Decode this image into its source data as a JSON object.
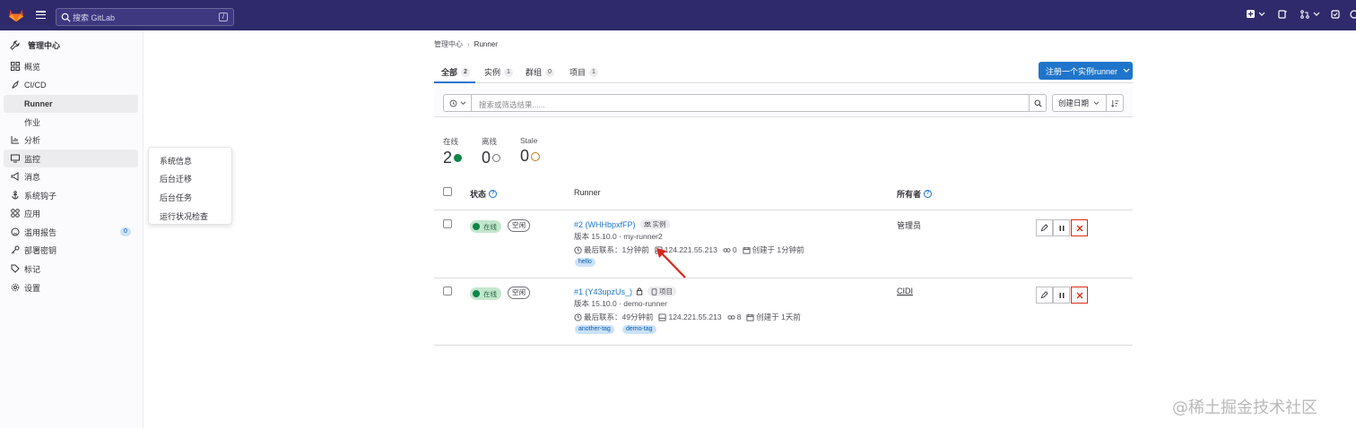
{
  "topbar": {
    "search_placeholder": "搜索 GitLab",
    "search_shortcut": "/"
  },
  "sidebar": {
    "header": "管理中心",
    "items": [
      {
        "label": "概览"
      },
      {
        "label": "CI/CD"
      },
      {
        "label": "Runner"
      },
      {
        "label": "作业"
      },
      {
        "label": "分析"
      },
      {
        "label": "监控"
      },
      {
        "label": "消息"
      },
      {
        "label": "系统钩子"
      },
      {
        "label": "应用"
      },
      {
        "label": "滥用报告",
        "badge": "0"
      },
      {
        "label": "部署密钥"
      },
      {
        "label": "标记"
      },
      {
        "label": "设置"
      }
    ],
    "flyout": [
      "系统信息",
      "后台迁移",
      "后台任务",
      "运行状况检查"
    ]
  },
  "breadcrumb": {
    "root": "管理中心",
    "current": "Runner"
  },
  "tabs": [
    {
      "label": "全部",
      "count": "2"
    },
    {
      "label": "实例",
      "count": "1"
    },
    {
      "label": "群组",
      "count": "0"
    },
    {
      "label": "项目",
      "count": "1"
    }
  ],
  "register_button": "注册一个实例runner",
  "filter": {
    "placeholder": "搜索或筛选结果......",
    "sort_label": "创建日期"
  },
  "stats": [
    {
      "label": "在线",
      "value": "2"
    },
    {
      "label": "离线",
      "value": "0"
    },
    {
      "label": "Stale",
      "value": "0"
    }
  ],
  "table": {
    "headers": {
      "status": "状态",
      "runner": "Runner",
      "owner": "所有者"
    },
    "rows": [
      {
        "status_online": "在线",
        "status_idle": "空闲",
        "title": "#2 (WHHbpxfFP)",
        "type": "实例",
        "version": "版本 15.10.0 · my-runner2",
        "last_contact": "最后联系：1分钟前",
        "ip": "124.221.55.213",
        "jobs": "0",
        "created": "创建于 1分钟前",
        "tags": [
          "hello"
        ],
        "owner": "管理员"
      },
      {
        "status_online": "在线",
        "status_idle": "空闲",
        "title": "#1 (Y43upzUs_)",
        "type": "项目",
        "version": "版本 15.10.0 · demo-runner",
        "last_contact": "最后联系：49分钟前",
        "ip": "124.221.55.213",
        "jobs": "8",
        "created": "创建于 1天前",
        "tags": [
          "another-tag",
          "demo-tag"
        ],
        "owner": "CIDI"
      }
    ]
  },
  "watermark": "@稀土掘金技术社区",
  "colors": {
    "topbar": "#2f2a6b",
    "primary": "#1f75cb",
    "online": "#108548",
    "danger": "#dd2b0e"
  }
}
